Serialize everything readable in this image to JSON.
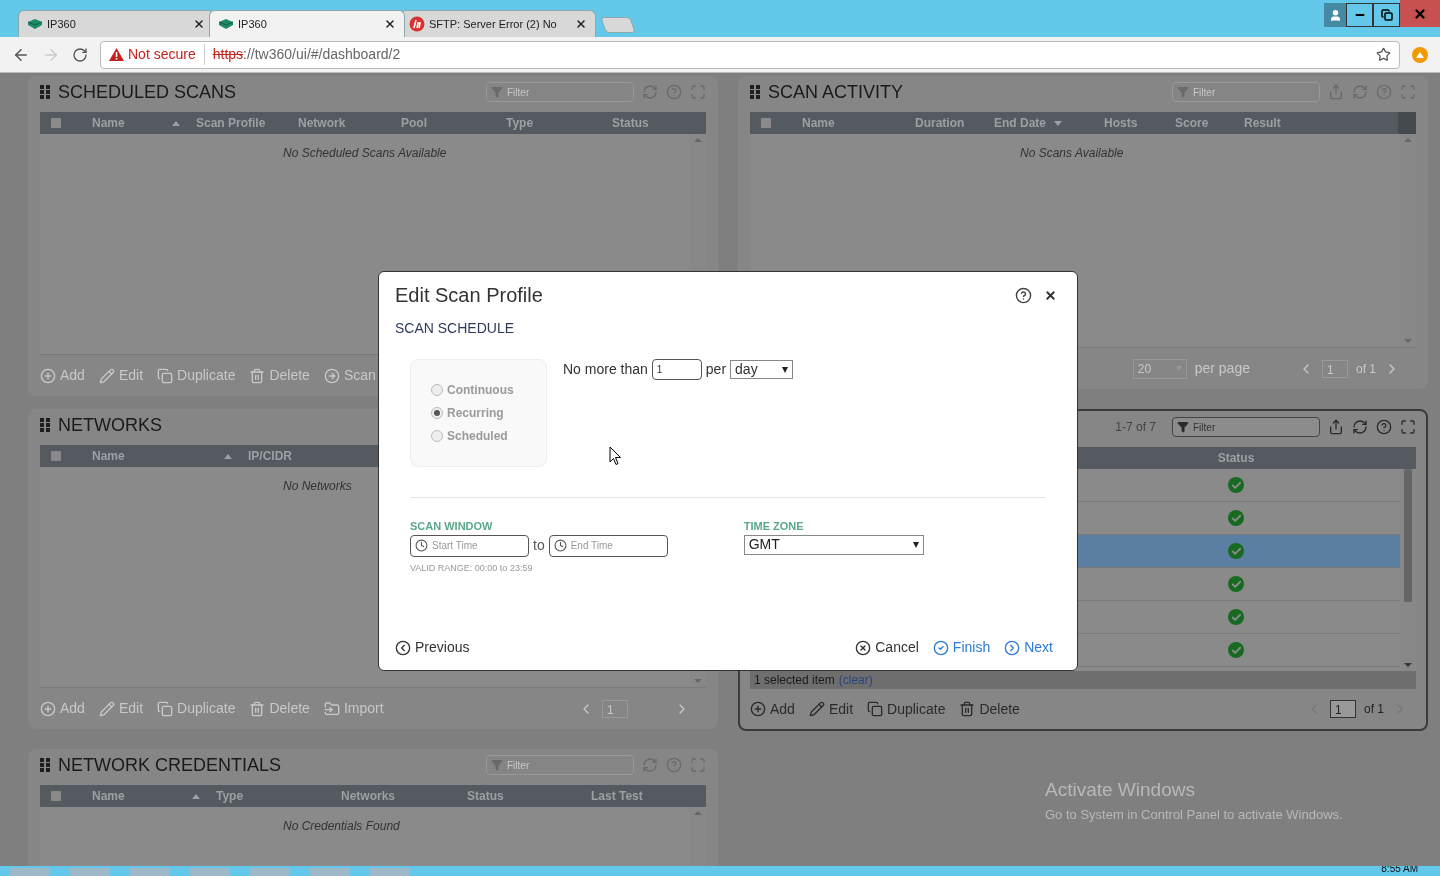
{
  "browser": {
    "tabs": [
      {
        "title": "IP360",
        "kind": "ip360",
        "selected": false
      },
      {
        "title": "IP360",
        "kind": "ip360",
        "selected": true
      },
      {
        "title": "SFTP: Server Error (2) No",
        "kind": "sftp",
        "selected": false
      }
    ],
    "security": "Not secure",
    "url_scheme": "https",
    "url_rest": "://tw360/ui/#/dashboard/2"
  },
  "left_panels": [
    {
      "title": "SCHEDULED SCANS",
      "filter_placeholder": "Filter",
      "select_all_checked": false,
      "columns": [
        {
          "label": "Name",
          "sorted_ascending": true
        },
        {
          "label": "Scan Profile"
        },
        {
          "label": "Network"
        },
        {
          "label": "Pool"
        },
        {
          "label": "Type"
        },
        {
          "label": "Status"
        }
      ],
      "empty_message": "No Scheduled Scans Available",
      "actions": [
        {
          "label": "Add",
          "kind": "add"
        },
        {
          "label": "Edit",
          "kind": "edit"
        },
        {
          "label": "Duplicate",
          "kind": "duplicate"
        },
        {
          "label": "Delete",
          "kind": "delete"
        },
        {
          "label": "Scan",
          "kind": "scan"
        }
      ]
    },
    {
      "title": "NETWORKS",
      "select_all_checked": false,
      "columns": [
        {
          "label": "Name",
          "sorted_ascending": true
        },
        {
          "label": "IP/CIDR"
        }
      ],
      "empty_message": "No Networks",
      "actions": [
        {
          "label": "Add",
          "kind": "add"
        },
        {
          "label": "Edit",
          "kind": "edit"
        },
        {
          "label": "Duplicate",
          "kind": "duplicate"
        },
        {
          "label": "Delete",
          "kind": "delete"
        },
        {
          "label": "Import",
          "kind": "import"
        }
      ],
      "page": "1"
    },
    {
      "title": "NETWORK CREDENTIALS",
      "filter_placeholder": "Filter",
      "select_all_checked": false,
      "columns": [
        {
          "label": "Name",
          "sorted_ascending": true
        },
        {
          "label": "Type"
        },
        {
          "label": "Networks"
        },
        {
          "label": "Status"
        },
        {
          "label": "Last Test"
        }
      ],
      "empty_message": "No Credentials Found"
    }
  ],
  "scan_activity": {
    "title": "SCAN ACTIVITY",
    "filter_placeholder": "Filter",
    "select_all_checked": false,
    "columns": [
      {
        "label": "Name"
      },
      {
        "label": "Duration"
      },
      {
        "label": "End Date",
        "sorted_descending": true
      },
      {
        "label": "Hosts"
      },
      {
        "label": "Score"
      },
      {
        "label": "Result"
      }
    ],
    "empty_message": "No Scans Available",
    "page_size": "20",
    "per_page": "per page",
    "page": "1",
    "of": "of 1"
  },
  "devices_panel": {
    "range": "1-7 of 7",
    "filter_placeholder": "Filter",
    "status_column": "Status",
    "rows": [
      {
        "kind": "ok",
        "selected": false
      },
      {
        "kind": "ok",
        "selected": false
      },
      {
        "kind": "ok",
        "selected": true
      },
      {
        "kind": "ok",
        "selected": false
      },
      {
        "kind": "ok",
        "selected": false
      },
      {
        "kind": "ok",
        "selected": false
      }
    ],
    "selection_text": "1 selected item",
    "clear_link": "(clear)",
    "actions": [
      {
        "label": "Add",
        "kind": "add"
      },
      {
        "label": "Edit",
        "kind": "edit"
      },
      {
        "label": "Duplicate",
        "kind": "duplicate"
      },
      {
        "label": "Delete",
        "kind": "delete"
      }
    ],
    "page": "1",
    "of": "of 1"
  },
  "modal": {
    "title": "Edit Scan Profile",
    "section": "SCAN SCHEDULE",
    "modes": [
      {
        "label": "Continuous",
        "selected": false
      },
      {
        "label": "Recurring",
        "selected": true
      },
      {
        "label": "Scheduled",
        "selected": false
      }
    ],
    "limit_prefix": "No more than",
    "limit_value": "1",
    "per": "per",
    "period": "day",
    "scan_window_label": "SCAN WINDOW",
    "start_placeholder": "Start Time",
    "to": "to",
    "end_placeholder": "End Time",
    "valid_range": "VALID RANGE: 00:00 to 23:59",
    "time_zone_label": "TIME ZONE",
    "time_zone": "GMT",
    "previous": "Previous",
    "cancel": "Cancel",
    "finish": "Finish",
    "next": "Next"
  },
  "watermark_os": {
    "title": "Activate Windows",
    "subtitle": "Go to System in Control Panel to activate Windows."
  },
  "taskbar": {
    "clock": "8:55 AM"
  }
}
